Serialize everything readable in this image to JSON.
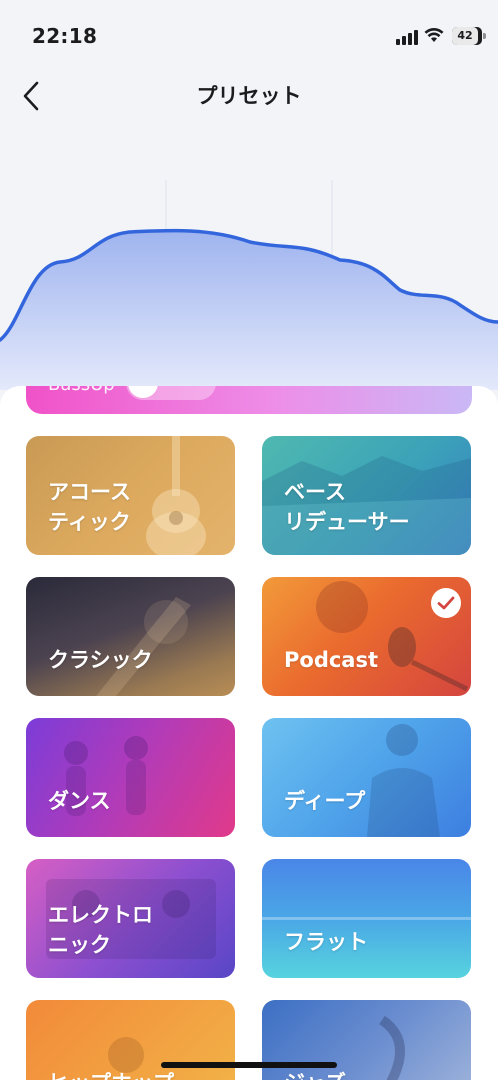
{
  "status_bar": {
    "time": "22:18",
    "battery": "42"
  },
  "nav": {
    "title": "プリセット",
    "back_icon": "chevron-left-icon"
  },
  "eq": {
    "curve_color": "#3366dd",
    "fill_top_color": "#9fb4ef",
    "fill_bottom_color": "#e4e9fb"
  },
  "partial_preset": {
    "label": "BassUp"
  },
  "presets": [
    {
      "label": "アコース\nティック",
      "selected": false
    },
    {
      "label": "ベース\nリデューサー",
      "selected": false
    },
    {
      "label": "クラシック",
      "selected": false
    },
    {
      "label": "Podcast",
      "selected": true
    },
    {
      "label": "ダンス",
      "selected": false
    },
    {
      "label": "ディープ",
      "selected": false
    },
    {
      "label": "エレクトロ\nニック",
      "selected": false
    },
    {
      "label": "フラット",
      "selected": false
    },
    {
      "label": "ヒップホップ",
      "selected": false
    },
    {
      "label": "ジャズ",
      "selected": false
    }
  ],
  "colors": {
    "background": "#f2f4f8",
    "accent": "#3366dd"
  }
}
